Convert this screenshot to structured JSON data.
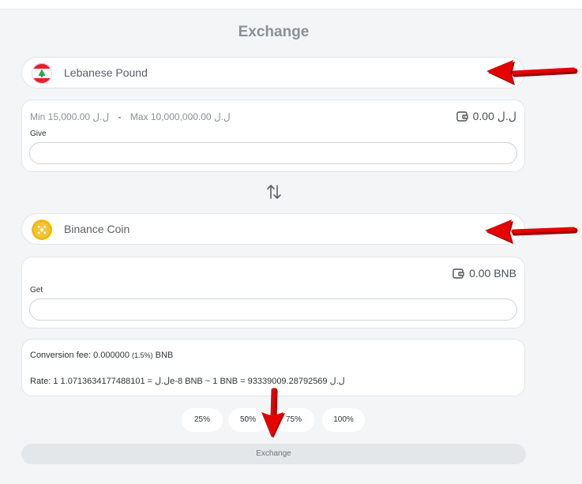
{
  "title": "Exchange",
  "from": {
    "currency_name": "Lebanese Pound",
    "flag_icon": "lebanon-flag-icon",
    "min_label": "Min 15,000.00 ل.ل",
    "separator": "-",
    "max_label": "Max 10,000,000.00 ل.ل",
    "balance": "0.00 ل.ل",
    "field_label": "Give",
    "value": ""
  },
  "swap_icon": "swap-arrows-icon",
  "to": {
    "currency_name": "Binance Coin",
    "coin_icon": "bnb-coin-icon",
    "balance": "0.00 BNB",
    "field_label": "Get",
    "value": ""
  },
  "info": {
    "fee_prefix": "Conversion fee: 0.000000",
    "fee_pct": "(1.5%)",
    "fee_suffix": "BNB",
    "rate": "Rate: 1 ل.ل = 1.0713634177488101e-8 BNB ~ 1 BNB = 93339009.28792569 ل.ل"
  },
  "percent_buttons": [
    "25%",
    "50%",
    "75%",
    "100%"
  ],
  "exchange_button": "Exchange",
  "colors": {
    "annotation_arrow": "#e60000",
    "flag_red": "#e8202a",
    "cedar_green": "#1f9c3c",
    "bnb_yellow": "#f0b90b"
  }
}
